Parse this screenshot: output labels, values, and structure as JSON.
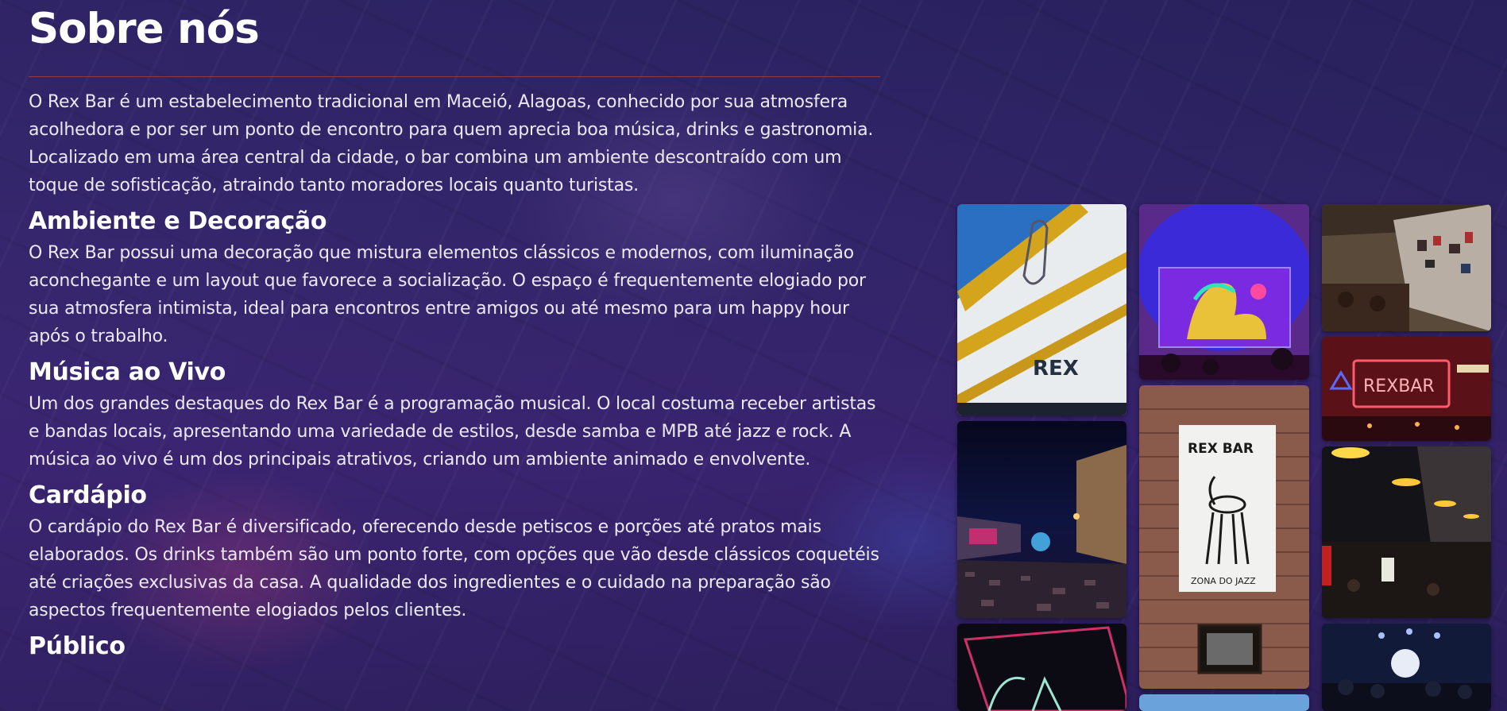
{
  "about": {
    "title": "Sobre nós",
    "intro": "O Rex Bar é um estabelecimento tradicional em Maceió, Alagoas, conhecido por sua atmosfera acolhedora e por ser um ponto de encontro para quem aprecia boa música, drinks e gastronomia. Localizado em uma área central da cidade, o bar combina um ambiente descontraído com um toque de sofisticação, atraindo tanto moradores locais quanto turistas.",
    "sections": [
      {
        "title": "Ambiente e Decoração",
        "text": "O Rex Bar possui uma decoração que mistura elementos clássicos e modernos, com iluminação aconchegante e um layout que favorece a socialização. O espaço é frequentemente elogiado por sua atmosfera intimista, ideal para encontros entre amigos ou até mesmo para um happy hour após o trabalho."
      },
      {
        "title": "Música ao Vivo",
        "text": "Um dos grandes destaques do Rex Bar é a programação musical. O local costuma receber artistas e bandas locais, apresentando uma variedade de estilos, desde samba e MPB até jazz e rock. A música ao vivo é um dos principais atrativos, criando um ambiente animado e envolvente."
      },
      {
        "title": "Cardápio",
        "text": "O cardápio do Rex Bar é diversificado, oferecendo desde petiscos e porções até pratos mais elaborados. Os drinks também são um ponto forte, com opções que vão desde clássicos coquetéis até criações exclusivas da casa. A qualidade dos ingredientes e o cuidado na preparação são aspectos frequentemente elogiados pelos clientes."
      },
      {
        "title": "Público",
        "text": ""
      }
    ]
  },
  "gallery": {
    "photo_labels": {
      "facade_sign": "REX",
      "wall_poster_title": "REX BAR",
      "wall_poster_caption": "ZONA DO JAZZ",
      "neon_sign": "REXBAR"
    }
  },
  "colors": {
    "accent_divider": "#b2443c",
    "text": "#ece8f4",
    "heading": "#ffffff"
  }
}
